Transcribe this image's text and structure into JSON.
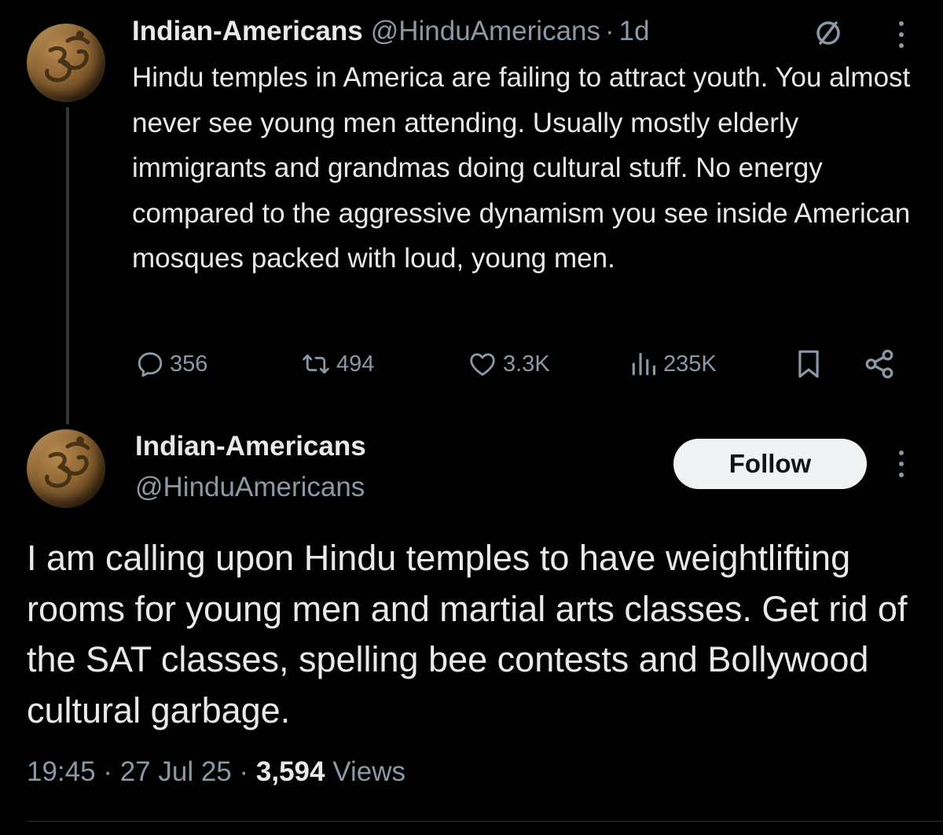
{
  "colors": {
    "background": "#000000",
    "primary_text": "#e7e9ea",
    "secondary_text": "#8b98a5",
    "follow_button_bg": "#eff3f4",
    "follow_button_text": "#0f1419"
  },
  "parent_tweet": {
    "display_name": "Indian-Americans",
    "handle": "@HinduAmericans",
    "separator": "·",
    "time_ago": "1d",
    "avatar_icon": "om-symbol-avatar",
    "body": "Hindu temples in America are failing to attract youth. You almost never see young men attending. Usually mostly elderly immigrants and grandmas doing cultural stuff. No energy compared to the aggressive dynamism you see inside American mosques packed with loud, young men.",
    "actions": {
      "replies": "356",
      "reposts": "494",
      "likes": "3.3K",
      "views": "235K"
    }
  },
  "main_tweet": {
    "display_name": "Indian-Americans",
    "handle": "@HinduAmericans",
    "avatar_icon": "om-symbol-avatar",
    "follow_label": "Follow",
    "body": "I am calling upon Hindu temples to have weightlifting rooms for young men and martial arts classes. Get rid of the SAT classes, spelling bee contests and Bollywood cultural garbage.",
    "time": "19:45",
    "date": "27 Jul 25",
    "separator": "·",
    "views_count": "3,594",
    "views_label": "Views"
  }
}
